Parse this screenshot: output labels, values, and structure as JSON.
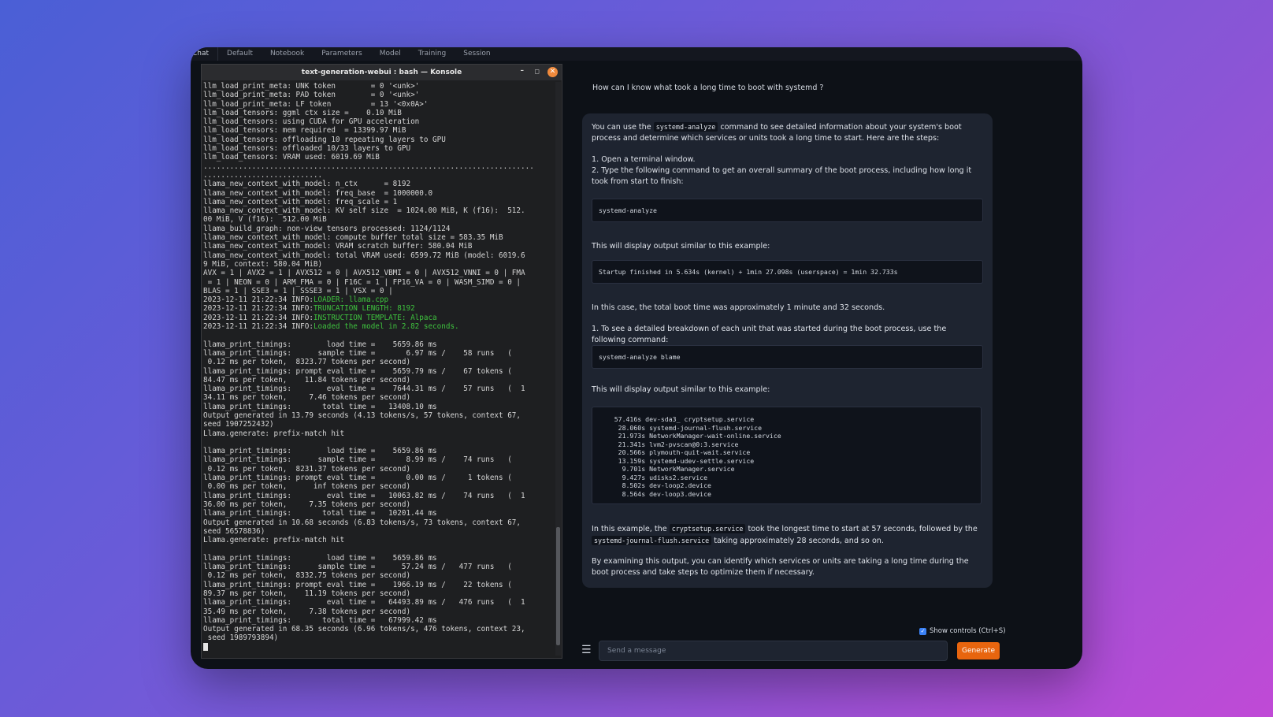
{
  "tabs": [
    "Chat",
    "Default",
    "Notebook",
    "Parameters",
    "Model",
    "Training",
    "Session"
  ],
  "konsole": {
    "title": "text-generation-webui : bash — Konsole",
    "minimize": "–",
    "maximize": "◻",
    "close": "✕",
    "lines": [
      {
        "t": "llm_load_print_meta: UNK token        = 0 '<unk>'"
      },
      {
        "t": "llm_load_print_meta: PAD token        = 0 '<unk>'"
      },
      {
        "t": "llm_load_print_meta: LF token         = 13 '<0x0A>'"
      },
      {
        "t": "llm_load_tensors: ggml ctx size =    0.10 MiB"
      },
      {
        "t": "llm_load_tensors: using CUDA for GPU acceleration"
      },
      {
        "t": "llm_load_tensors: mem required  = 13399.97 MiB"
      },
      {
        "t": "llm_load_tensors: offloading 10 repeating layers to GPU"
      },
      {
        "t": "llm_load_tensors: offloaded 10/33 layers to GPU"
      },
      {
        "t": "llm_load_tensors: VRAM used: 6019.69 MiB"
      },
      {
        "t": "..........................................................................."
      },
      {
        "t": "..........................."
      },
      {
        "t": "llama_new_context_with_model: n_ctx      = 8192"
      },
      {
        "t": "llama_new_context_with_model: freq_base  = 1000000.0"
      },
      {
        "t": "llama_new_context_with_model: freq_scale = 1"
      },
      {
        "t": "llama_new_context_with_model: KV self size  = 1024.00 MiB, K (f16):  512."
      },
      {
        "t": "00 MiB, V (f16):  512.00 MiB"
      },
      {
        "t": "llama_build_graph: non-view tensors processed: 1124/1124"
      },
      {
        "t": "llama_new_context_with_model: compute buffer total size = 583.35 MiB"
      },
      {
        "t": "llama_new_context_with_model: VRAM scratch buffer: 580.04 MiB"
      },
      {
        "t": "llama_new_context_with_model: total VRAM used: 6599.72 MiB (model: 6019.6"
      },
      {
        "t": "9 MiB, context: 580.04 MiB)"
      },
      {
        "t": "AVX = 1 | AVX2 = 1 | AVX512 = 0 | AVX512_VBMI = 0 | AVX512_VNNI = 0 | FMA"
      },
      {
        "t": " = 1 | NEON = 0 | ARM_FMA = 0 | F16C = 1 | FP16_VA = 0 | WASM_SIMD = 0 |"
      },
      {
        "t": "BLAS = 1 | SSE3 = 1 | SSSE3 = 1 | VSX = 0 |"
      },
      {
        "t": "2023-12-11 21:22:34 INFO:",
        "g": "LOADER: llama.cpp"
      },
      {
        "t": "2023-12-11 21:22:34 INFO:",
        "g": "TRUNCATION LENGTH: 8192"
      },
      {
        "t": "2023-12-11 21:22:34 INFO:",
        "g": "INSTRUCTION TEMPLATE: Alpaca"
      },
      {
        "t": "2023-12-11 21:22:34 INFO:",
        "g": "Loaded the model in 2.82 seconds."
      },
      {
        "t": ""
      },
      {
        "t": "llama_print_timings:        load time =    5659.86 ms"
      },
      {
        "t": "llama_print_timings:      sample time =       6.97 ms /    58 runs   ("
      },
      {
        "t": " 0.12 ms per token,  8323.77 tokens per second)"
      },
      {
        "t": "llama_print_timings: prompt eval time =    5659.79 ms /    67 tokens ("
      },
      {
        "t": "84.47 ms per token,    11.84 tokens per second)"
      },
      {
        "t": "llama_print_timings:        eval time =    7644.31 ms /    57 runs   (  1"
      },
      {
        "t": "34.11 ms per token,     7.46 tokens per second)"
      },
      {
        "t": "llama_print_timings:       total time =   13408.10 ms"
      },
      {
        "t": "Output generated in 13.79 seconds (4.13 tokens/s, 57 tokens, context 67,"
      },
      {
        "t": "seed 1907252432)"
      },
      {
        "t": "Llama.generate: prefix-match hit"
      },
      {
        "t": ""
      },
      {
        "t": "llama_print_timings:        load time =    5659.86 ms"
      },
      {
        "t": "llama_print_timings:      sample time =       8.99 ms /    74 runs   ("
      },
      {
        "t": " 0.12 ms per token,  8231.37 tokens per second)"
      },
      {
        "t": "llama_print_timings: prompt eval time =       0.00 ms /     1 tokens ("
      },
      {
        "t": " 0.00 ms per token,      inf tokens per second)"
      },
      {
        "t": "llama_print_timings:        eval time =   10063.82 ms /    74 runs   (  1"
      },
      {
        "t": "36.00 ms per token,     7.35 tokens per second)"
      },
      {
        "t": "llama_print_timings:       total time =   10201.44 ms"
      },
      {
        "t": "Output generated in 10.68 seconds (6.83 tokens/s, 73 tokens, context 67,"
      },
      {
        "t": "seed 56578836)"
      },
      {
        "t": "Llama.generate: prefix-match hit"
      },
      {
        "t": ""
      },
      {
        "t": "llama_print_timings:        load time =    5659.86 ms"
      },
      {
        "t": "llama_print_timings:      sample time =      57.24 ms /   477 runs   ("
      },
      {
        "t": " 0.12 ms per token,  8332.75 tokens per second)"
      },
      {
        "t": "llama_print_timings: prompt eval time =    1966.19 ms /    22 tokens ("
      },
      {
        "t": "89.37 ms per token,    11.19 tokens per second)"
      },
      {
        "t": "llama_print_timings:        eval time =   64493.89 ms /   476 runs   (  1"
      },
      {
        "t": "35.49 ms per token,     7.38 tokens per second)"
      },
      {
        "t": "llama_print_timings:       total time =   67999.42 ms"
      },
      {
        "t": "Output generated in 68.35 seconds (6.96 tokens/s, 476 tokens, context 23,"
      },
      {
        "t": " seed 1989793894)"
      }
    ]
  },
  "chat": {
    "user_message": "How can I know what took a long time to boot with systemd ?",
    "p1_a": "You can use the ",
    "p1_code": "systemd-analyze",
    "p1_b": " command to see detailed information about your system's boot process and determine which services or units took a long time to start. Here are the steps:",
    "step1": "1.  Open a terminal window.",
    "step2": "2.  Type the following command to get an overall summary of the boot process, including how long it took from start to finish:",
    "code1": "systemd-analyze",
    "p2": "This will display output similar to this example:",
    "code2": "Startup finished in 5.634s (kernel) + 1min 27.098s (userspace) = 1min 32.733s",
    "p3": "In this case, the total boot time was approximately 1 minute and 32 seconds.",
    "p4": "1. To see a detailed breakdown of each unit that was started during the boot process, use the following command:",
    "code3": "systemd-analyze blame",
    "p5": "This will display output similar to this example:",
    "blame": [
      "    57.416s dev-sda3_ cryptsetup.service",
      "     28.060s systemd-journal-flush.service",
      "     21.973s NetworkManager-wait-online.service",
      "     21.341s lvm2-pvscan@0:3.service",
      "     20.566s plymouth-quit-wait.service",
      "     13.159s systemd-udev-settle.service",
      "      9.701s NetworkManager.service",
      "      9.427s udisks2.service",
      "      8.502s dev-loop2.device",
      "      8.564s dev-loop3.device"
    ],
    "p6_a": "In this example, the ",
    "p6_code1": "cryptsetup.service",
    "p6_b": " took the longest time to start at 57 seconds, followed by the ",
    "p6_code2": "systemd-journal-flush.service",
    "p6_c": " taking approximately 28 seconds, and so on.",
    "p7": "By examining this output, you can identify which services or units are taking a long time during the boot process and take steps to optimize them if necessary."
  },
  "controls": {
    "show_controls": "Show controls (Ctrl+S)",
    "input_placeholder": "Send a message",
    "generate": "Generate",
    "menu_icon": "hamburger-menu-icon"
  }
}
